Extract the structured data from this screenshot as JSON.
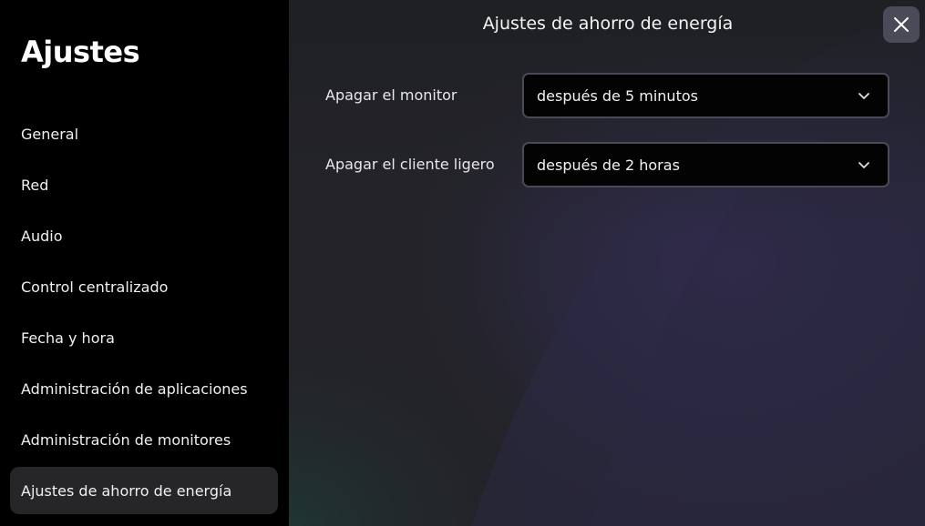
{
  "sidebar": {
    "title": "Ajustes",
    "items": [
      {
        "label": "General"
      },
      {
        "label": "Red"
      },
      {
        "label": "Audio"
      },
      {
        "label": "Control centralizado"
      },
      {
        "label": "Fecha y hora"
      },
      {
        "label": "Administración de aplicaciones"
      },
      {
        "label": "Administración de monitores"
      },
      {
        "label": "Ajustes de ahorro de energía",
        "active": true
      }
    ]
  },
  "panel": {
    "title": "Ajustes de ahorro de energía",
    "close_icon": "close-icon",
    "settings": [
      {
        "label": "Apagar el monitor",
        "value": "después de 5 minutos",
        "icon": "chevron-down-icon"
      },
      {
        "label": "Apagar el cliente ligero",
        "value": "después de 2 horas",
        "icon": "chevron-down-icon"
      }
    ]
  },
  "colors": {
    "sidebar_bg": "#000000",
    "panel_bg": "#24242b",
    "active_item_bg": "#262629",
    "select_bg": "#030303",
    "select_border": "#4a4a56",
    "close_button_bg": "#4a4a58"
  }
}
